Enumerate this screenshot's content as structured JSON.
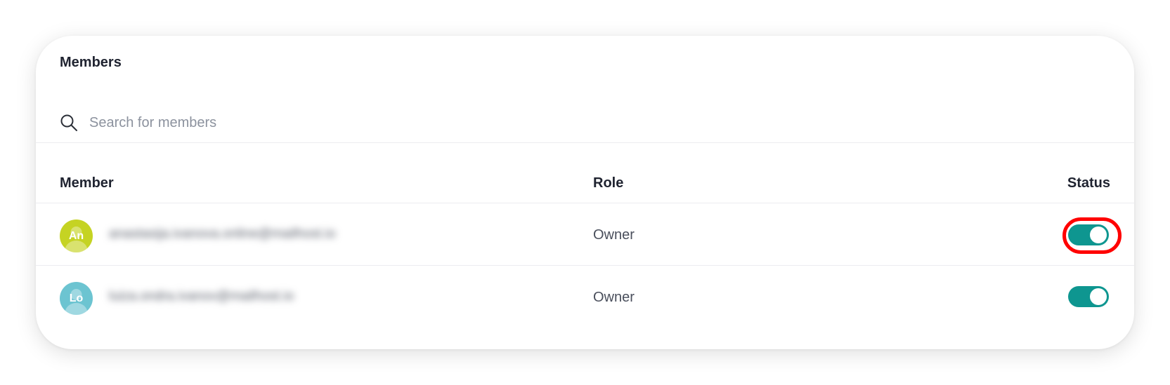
{
  "members_card": {
    "title": "Members",
    "search": {
      "placeholder": "Search for members",
      "value": ""
    },
    "columns": {
      "member": "Member",
      "role": "Role",
      "status": "Status"
    },
    "rows": [
      {
        "initials": "An",
        "avatar_color": "#c5d323",
        "email": "anastasija.ivanova.online@mailhost.io",
        "role": "Owner",
        "status_enabled": true,
        "highlighted": true
      },
      {
        "initials": "Lo",
        "avatar_color": "#6cc4d1",
        "email": "luiza.ondra.ivanov@mailhost.io",
        "role": "Owner",
        "status_enabled": true,
        "highlighted": false
      }
    ]
  },
  "colors": {
    "accent": "#0e9690",
    "highlight": "#ff0000",
    "text": "#1f2330",
    "placeholder": "#8c929e"
  },
  "icons": {
    "search": "search-icon",
    "avatar": "avatar-person-icon"
  }
}
